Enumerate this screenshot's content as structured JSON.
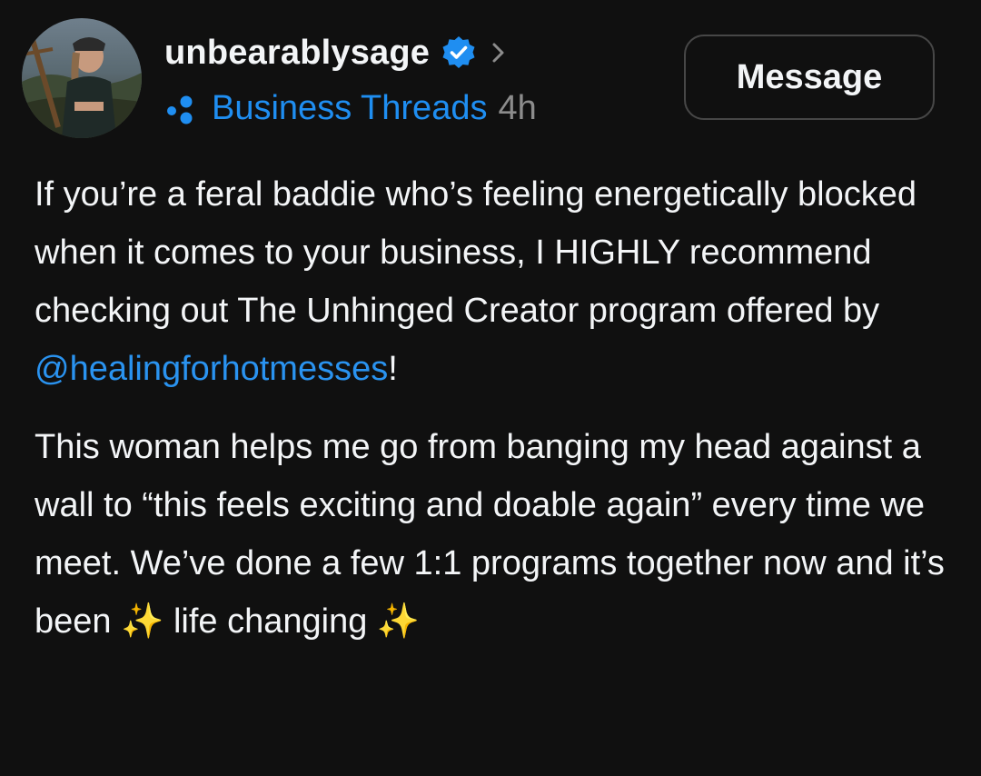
{
  "post": {
    "author": {
      "username": "unbearablysage",
      "verified": true,
      "verified_icon": "verified-badge-icon",
      "chevron_icon": "chevron-right-icon"
    },
    "topic": {
      "label": "Business Threads",
      "icon": "topic-dots-icon"
    },
    "timestamp": "4h",
    "message_button_label": "Message",
    "paragraph_1": {
      "text": "If you’re a feral baddie who’s feeling energetically blocked when it comes to your business, I HIGHLY recommend checking out The Unhinged Creator program offered by ",
      "mention": "@healingforhotmesses",
      "after_mention": "!"
    },
    "paragraph_2": {
      "text_before_sparkle": "This woman helps me go from banging my head against a wall to “this feels exciting and doable again” every time we meet. We’ve done a few 1:1 programs together now and it’s been ",
      "sparkle_1": "✨",
      "text_between": " life changing ",
      "sparkle_2": "✨"
    }
  },
  "colors": {
    "background": "#101010",
    "text": "#f3f5f7",
    "accent_blue": "#1f8ef1",
    "muted": "#8c8c8c",
    "button_border": "#474747"
  }
}
